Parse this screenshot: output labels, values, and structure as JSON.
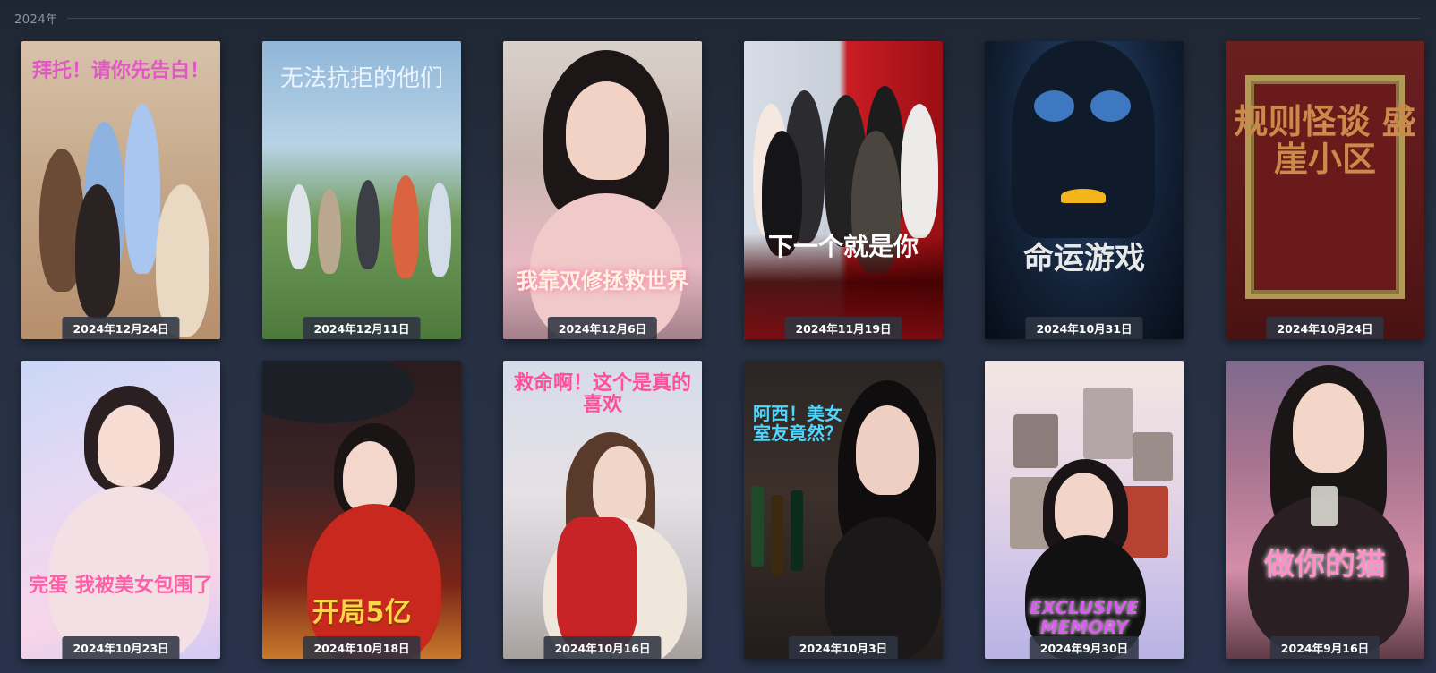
{
  "section": {
    "year_label": "2024年"
  },
  "items": [
    {
      "title_art": "拜托！请你先告白！",
      "date": "2024年12月24日",
      "title_color": "#e455c8"
    },
    {
      "title_art": "无法抗拒的他们",
      "date": "2024年12月11日",
      "title_color": "#eaf4ff"
    },
    {
      "title_art": "我靠双修拯救世界",
      "date": "2024年12月6日",
      "title_color": "#fff4e0"
    },
    {
      "title_art": "下一个就是你",
      "date": "2024年11月19日",
      "title_color": "#ffffff"
    },
    {
      "title_art": "命运游戏",
      "date": "2024年10月31日",
      "title_color": "#e8e8e8"
    },
    {
      "title_art": "规则怪谈 盛崖小区",
      "date": "2024年10月24日",
      "title_color": "#c98a4b"
    },
    {
      "title_art": "完蛋 我被美女包围了",
      "date": "2024年10月23日",
      "title_color": "#ff5fa8"
    },
    {
      "title_art": "开局5亿",
      "date": "2024年10月18日",
      "title_color": "#ffd34a"
    },
    {
      "title_art": "救命啊！这个是真的喜欢",
      "date": "2024年10月16日",
      "title_color": "#ff4f9a"
    },
    {
      "title_art": "阿西！美女室友竟然？",
      "date": "2024年10月3日",
      "title_color": "#4fd6ff"
    },
    {
      "title_art": "EXCLUSIVE MEMORY",
      "date": "2024年9月30日",
      "title_color": "#d95cf0"
    },
    {
      "title_art": "做你的猫",
      "date": "2024年9月16日",
      "title_color": "#ff8fc8"
    }
  ]
}
